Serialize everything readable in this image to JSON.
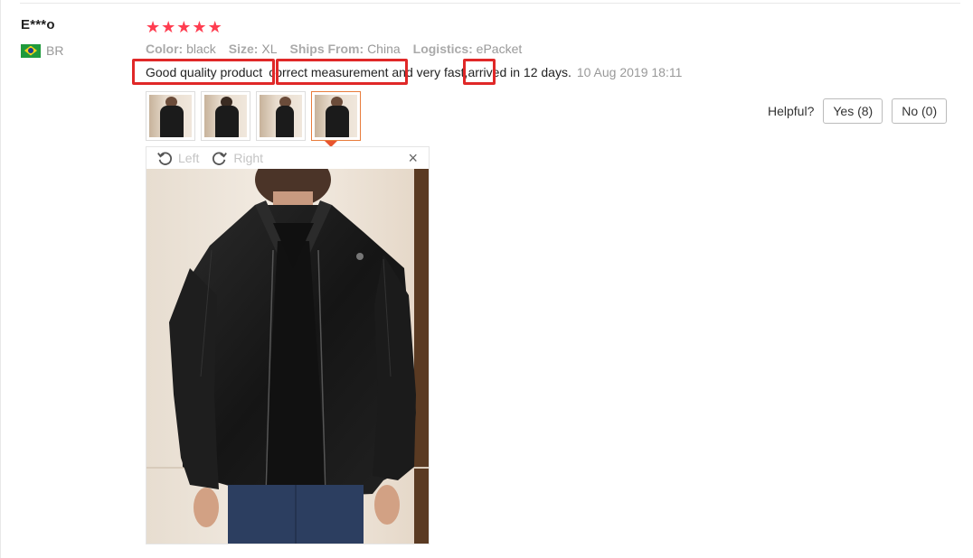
{
  "reviewer": {
    "name": "E***o",
    "country": "BR"
  },
  "rating": {
    "stars": 5,
    "max": 5
  },
  "attributes": [
    {
      "key": "Color:",
      "value": "black"
    },
    {
      "key": "Size:",
      "value": "XL"
    },
    {
      "key": "Ships From:",
      "value": "China"
    },
    {
      "key": "Logistics:",
      "value": "ePacket"
    }
  ],
  "review": {
    "segments": [
      "Good quality product",
      "correct measurement",
      " and very ",
      "fast,",
      "arrived in 12 days."
    ],
    "date": "10 Aug 2019 18:11"
  },
  "helpful": {
    "label": "Helpful?",
    "yes": "Yes (8)",
    "no": "No (0)"
  },
  "viewer": {
    "rotate_left": "Left",
    "rotate_right": "Right",
    "close_symbol": "×"
  },
  "thumbnails": {
    "count": 4,
    "active_index": 3
  },
  "colors": {
    "star": "#ff3d50",
    "highlight": "#e02828",
    "active_thumb": "#e87c3b"
  }
}
